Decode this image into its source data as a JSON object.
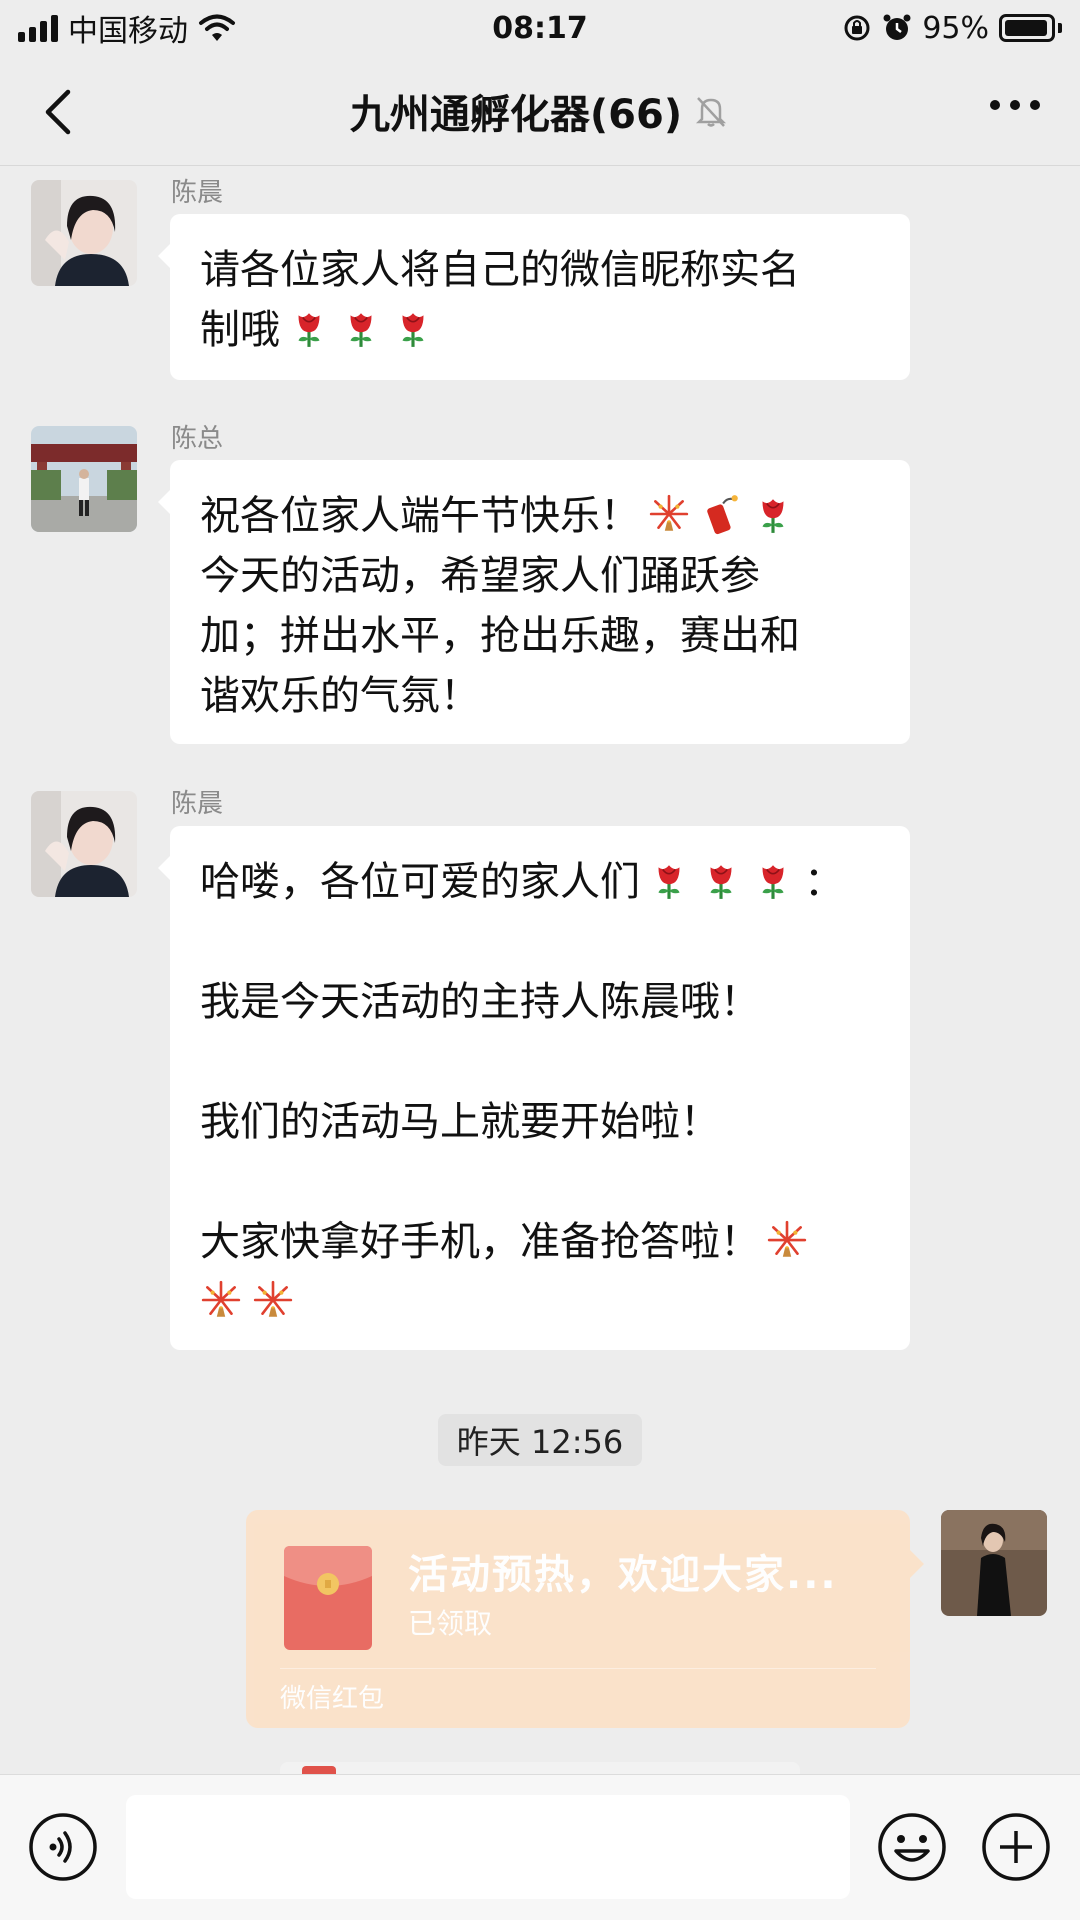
{
  "status_bar": {
    "carrier": "中国移动",
    "time": "08:17",
    "battery": "95%"
  },
  "nav": {
    "title": "九州通孵化器(66)"
  },
  "messages": [
    {
      "sender": "陈晨",
      "lines": [
        "请各位家人将自己的微信昵称实名",
        "制哦"
      ],
      "emojis": [
        "rose-emoji",
        "rose-emoji",
        "rose-emoji"
      ]
    },
    {
      "sender": "陈总",
      "lines": [
        "祝各位家人端午节快乐！",
        "今天的活动，希望家人们踊跃参",
        "加；拼出水平，抢出乐趣，赛出和",
        "谐欢乐的气氛！"
      ],
      "emojis": [
        "fireworks-emoji",
        "firecracker-emoji",
        "rose-emoji"
      ]
    },
    {
      "sender": "陈晨",
      "lines": [
        "哈喽，各位可爱的家人们",
        "：",
        "我是今天活动的主持人陈晨哦！",
        "我们的活动马上就要开始啦！",
        "大家快拿好手机，准备抢答啦！"
      ],
      "emojis": [
        "rose-emoji",
        "rose-emoji",
        "rose-emoji",
        "fireworks-emoji",
        "fireworks-emoji",
        "fireworks-emoji"
      ]
    }
  ],
  "timestamp": "昨天 12:56",
  "red_packet": {
    "title": "活动预热，欢迎大家...",
    "status": "已领取",
    "footer": "微信红包"
  },
  "icons": {
    "back": "chevron-left-icon",
    "mute": "bell-muted-icon",
    "more": "more-icon",
    "voice": "voice-icon",
    "emoji": "emoji-icon",
    "plus": "plus-icon"
  },
  "colors": {
    "background": "#ededed",
    "bubble": "#ffffff",
    "red_packet": "#fbe2c9",
    "sender_name": "#8a8a8a"
  }
}
